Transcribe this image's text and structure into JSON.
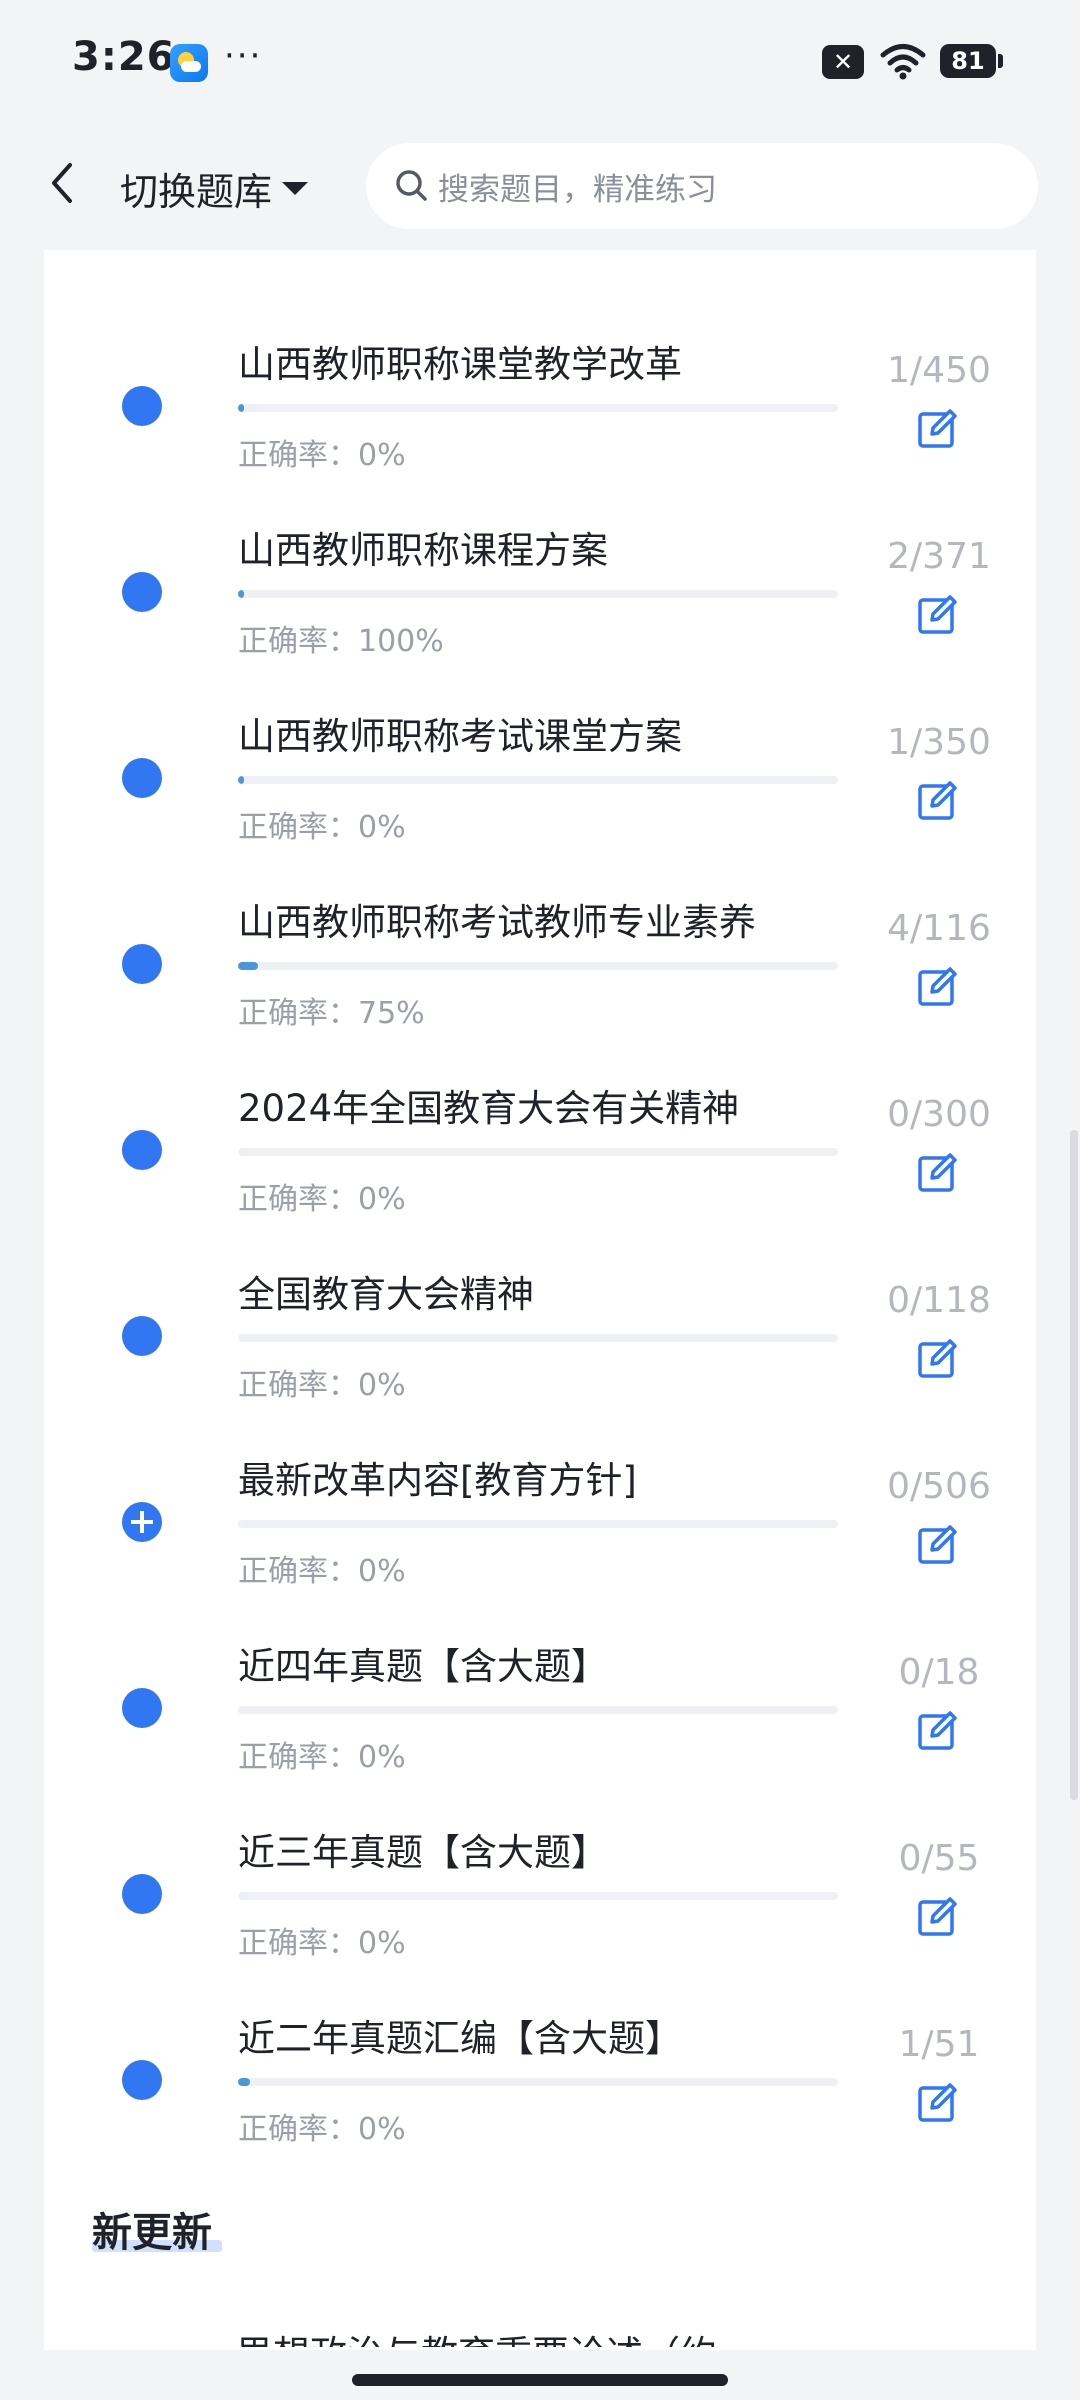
{
  "status_bar": {
    "time": "3:26",
    "more": "···",
    "battery": "81"
  },
  "header": {
    "switch_label": "切换题库",
    "search_placeholder": "搜索题目，精准练习"
  },
  "rate_prefix": "正确率：",
  "items": [
    {
      "title": "山西教师职称课堂教学改革",
      "count": "1/450",
      "rate": "正确率：0%",
      "progress": 0.002,
      "icon": "dot"
    },
    {
      "title": "山西教师职称课程方案",
      "count": "2/371",
      "rate": "正确率：100%",
      "progress": 0.005,
      "icon": "dot"
    },
    {
      "title": "山西教师职称考试课堂方案",
      "count": "1/350",
      "rate": "正确率：0%",
      "progress": 0.003,
      "icon": "dot"
    },
    {
      "title": "山西教师职称考试教师专业素养",
      "count": "4/116",
      "rate": "正确率：75%",
      "progress": 0.034,
      "icon": "dot"
    },
    {
      "title": "2024年全国教育大会有关精神",
      "count": "0/300",
      "rate": "正确率：0%",
      "progress": 0,
      "icon": "dot"
    },
    {
      "title": "全国教育大会精神",
      "count": "0/118",
      "rate": "正确率：0%",
      "progress": 0,
      "icon": "dot"
    },
    {
      "title": "最新改革内容[教育方针]",
      "count": "0/506",
      "rate": "正确率：0%",
      "progress": 0,
      "icon": "plus"
    },
    {
      "title": "近四年真题【含大题】",
      "count": "0/18",
      "rate": "正确率：0%",
      "progress": 0,
      "icon": "dot"
    },
    {
      "title": "近三年真题【含大题】",
      "count": "0/55",
      "rate": "正确率：0%",
      "progress": 0,
      "icon": "dot"
    },
    {
      "title": "近二年真题汇编【含大题】",
      "count": "1/51",
      "rate": "正确率：0%",
      "progress": 0.02,
      "icon": "dot"
    }
  ],
  "section": {
    "title": "新更新",
    "first_item_partial": "思想政治与教育重要论述（约"
  },
  "colors": {
    "accent": "#3177f1",
    "progress": "#4a97d8",
    "muted": "#9aa0a8"
  }
}
